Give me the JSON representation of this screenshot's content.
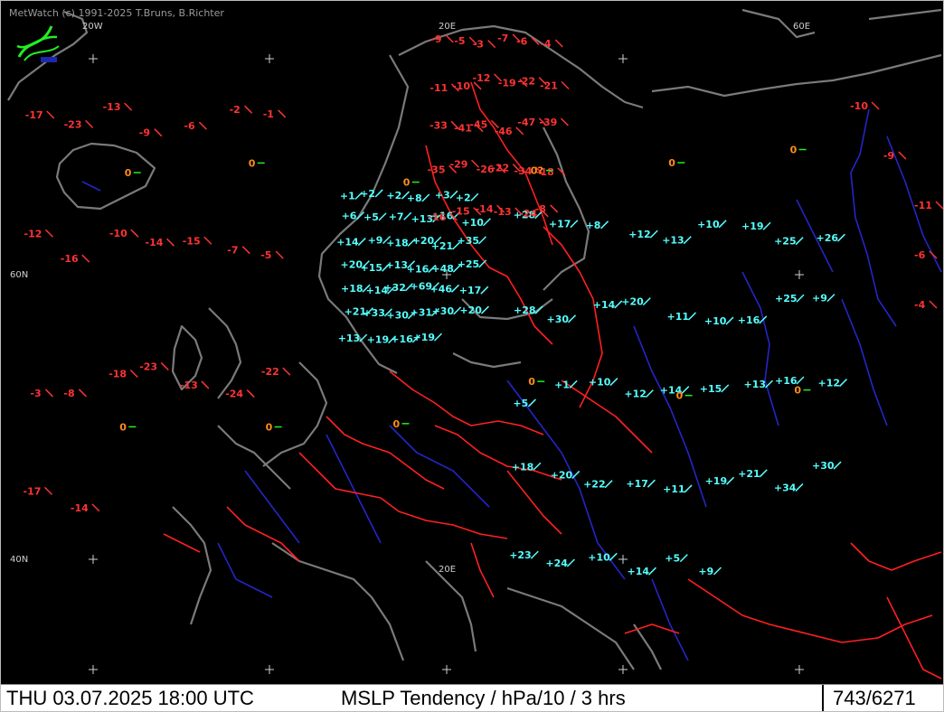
{
  "header": {
    "credit": "MetWatch  (c) 1991-2025 T.Bruns, B.Richter"
  },
  "graticule": [
    {
      "text": "20W",
      "name": "lon-label-20w"
    },
    {
      "text": "20E",
      "name": "lon-label-20e"
    },
    {
      "text": "60E",
      "name": "lon-label-60e"
    },
    {
      "text": "60N",
      "name": "lat-label-60n"
    },
    {
      "text": "40N",
      "name": "lat-label-40n"
    },
    {
      "text": "20E",
      "name": "lon-label-20e-south"
    }
  ],
  "footer": {
    "datetime": "THU 03.07.2025 18:00 UTC",
    "parameter": "MSLP Tendency / hPa/10 / 3 hrs",
    "station_count": "743/6271"
  },
  "legend": {
    "rising_color": "#55ffff",
    "falling_color": "#ff3333",
    "steady_color": "#ff8c1a",
    "border_color": "#ff2020",
    "coast_color": "#7a7a7a",
    "river_color": "#2525c8"
  },
  "observations": [
    {
      "v": "+1",
      "c": "r"
    },
    {
      "v": "+2",
      "c": "r"
    },
    {
      "v": "+2",
      "c": "r"
    },
    {
      "v": "+8",
      "c": "r"
    },
    {
      "v": "+3",
      "c": "r"
    },
    {
      "v": "+2",
      "c": "r"
    },
    {
      "v": "+6",
      "c": "r"
    },
    {
      "v": "+5",
      "c": "r"
    },
    {
      "v": "+7",
      "c": "r"
    },
    {
      "v": "+13",
      "c": "r"
    },
    {
      "v": "+16",
      "c": "r"
    },
    {
      "v": "+10",
      "c": "r"
    },
    {
      "v": "+14",
      "c": "r"
    },
    {
      "v": "+9",
      "c": "r"
    },
    {
      "v": "+18",
      "c": "r"
    },
    {
      "v": "+20",
      "c": "r"
    },
    {
      "v": "+21",
      "c": "r"
    },
    {
      "v": "+35",
      "c": "r"
    },
    {
      "v": "+20",
      "c": "r"
    },
    {
      "v": "+15",
      "c": "r"
    },
    {
      "v": "+13",
      "c": "r"
    },
    {
      "v": "+16",
      "c": "r"
    },
    {
      "v": "+48",
      "c": "r"
    },
    {
      "v": "+25",
      "c": "r"
    },
    {
      "v": "+18",
      "c": "r"
    },
    {
      "v": "+14",
      "c": "r"
    },
    {
      "v": "+32",
      "c": "r"
    },
    {
      "v": "+69",
      "c": "r"
    },
    {
      "v": "+46",
      "c": "r"
    },
    {
      "v": "+17",
      "c": "r"
    },
    {
      "v": "+21",
      "c": "r"
    },
    {
      "v": "+33",
      "c": "r"
    },
    {
      "v": "+30",
      "c": "r"
    },
    {
      "v": "+31",
      "c": "r"
    },
    {
      "v": "+30",
      "c": "r"
    },
    {
      "v": "+20",
      "c": "r"
    },
    {
      "v": "+13",
      "c": "r"
    },
    {
      "v": "+19",
      "c": "r"
    },
    {
      "v": "+16",
      "c": "r"
    },
    {
      "v": "+19",
      "c": "r"
    },
    {
      "v": "+28",
      "c": "r"
    },
    {
      "v": "+17",
      "c": "r"
    },
    {
      "v": "+8",
      "c": "r"
    },
    {
      "v": "+12",
      "c": "r"
    },
    {
      "v": "+13",
      "c": "r"
    },
    {
      "v": "+10",
      "c": "r"
    },
    {
      "v": "+19",
      "c": "r"
    },
    {
      "v": "+25",
      "c": "r"
    },
    {
      "v": "+26",
      "c": "r"
    },
    {
      "v": "+28",
      "c": "r"
    },
    {
      "v": "+30",
      "c": "r"
    },
    {
      "v": "+14",
      "c": "r"
    },
    {
      "v": "+20",
      "c": "r"
    },
    {
      "v": "+11",
      "c": "r"
    },
    {
      "v": "+10",
      "c": "r"
    },
    {
      "v": "+16",
      "c": "r"
    },
    {
      "v": "+25",
      "c": "r"
    },
    {
      "v": "+9",
      "c": "r"
    },
    {
      "v": "+5",
      "c": "r"
    },
    {
      "v": "+1",
      "c": "r"
    },
    {
      "v": "+10",
      "c": "r"
    },
    {
      "v": "+12",
      "c": "r"
    },
    {
      "v": "+14",
      "c": "r"
    },
    {
      "v": "+15",
      "c": "r"
    },
    {
      "v": "+13",
      "c": "r"
    },
    {
      "v": "+16",
      "c": "r"
    },
    {
      "v": "+12",
      "c": "r"
    },
    {
      "v": "+18",
      "c": "r"
    },
    {
      "v": "+20",
      "c": "r"
    },
    {
      "v": "+22",
      "c": "r"
    },
    {
      "v": "+17",
      "c": "r"
    },
    {
      "v": "+11",
      "c": "r"
    },
    {
      "v": "+19",
      "c": "r"
    },
    {
      "v": "+21",
      "c": "r"
    },
    {
      "v": "+34",
      "c": "r"
    },
    {
      "v": "+30",
      "c": "r"
    },
    {
      "v": "+23",
      "c": "r"
    },
    {
      "v": "+24",
      "c": "r"
    },
    {
      "v": "+10",
      "c": "r"
    },
    {
      "v": "+14",
      "c": "r"
    },
    {
      "v": "+5",
      "c": "r"
    },
    {
      "v": "+9",
      "c": "r"
    },
    {
      "v": "-9",
      "c": "f"
    },
    {
      "v": "-5",
      "c": "f"
    },
    {
      "v": "-3",
      "c": "f"
    },
    {
      "v": "-7",
      "c": "f"
    },
    {
      "v": "-6",
      "c": "f"
    },
    {
      "v": "-4",
      "c": "f"
    },
    {
      "v": "-11",
      "c": "f"
    },
    {
      "v": "-10",
      "c": "f"
    },
    {
      "v": "-12",
      "c": "f"
    },
    {
      "v": "-19",
      "c": "f"
    },
    {
      "v": "-22",
      "c": "f"
    },
    {
      "v": "-21",
      "c": "f"
    },
    {
      "v": "-33",
      "c": "f"
    },
    {
      "v": "-41",
      "c": "f"
    },
    {
      "v": "-45",
      "c": "f"
    },
    {
      "v": "-46",
      "c": "f"
    },
    {
      "v": "-47",
      "c": "f"
    },
    {
      "v": "-39",
      "c": "f"
    },
    {
      "v": "-35",
      "c": "f"
    },
    {
      "v": "-29",
      "c": "f"
    },
    {
      "v": "-26",
      "c": "f"
    },
    {
      "v": "-22",
      "c": "f"
    },
    {
      "v": "-34",
      "c": "f"
    },
    {
      "v": "-18",
      "c": "f"
    },
    {
      "v": "-16",
      "c": "f"
    },
    {
      "v": "-15",
      "c": "f"
    },
    {
      "v": "-14",
      "c": "f"
    },
    {
      "v": "-13",
      "c": "f"
    },
    {
      "v": "-24",
      "c": "f"
    },
    {
      "v": "-8",
      "c": "f"
    },
    {
      "v": "-17",
      "c": "f"
    },
    {
      "v": "-23",
      "c": "f"
    },
    {
      "v": "-13",
      "c": "f"
    },
    {
      "v": "-9",
      "c": "f"
    },
    {
      "v": "-6",
      "c": "f"
    },
    {
      "v": "-2",
      "c": "f"
    },
    {
      "v": "-1",
      "c": "f"
    },
    {
      "v": "-12",
      "c": "f"
    },
    {
      "v": "-16",
      "c": "f"
    },
    {
      "v": "-10",
      "c": "f"
    },
    {
      "v": "-14",
      "c": "f"
    },
    {
      "v": "-15",
      "c": "f"
    },
    {
      "v": "-7",
      "c": "f"
    },
    {
      "v": "-5",
      "c": "f"
    },
    {
      "v": "-3",
      "c": "f"
    },
    {
      "v": "-8",
      "c": "f"
    },
    {
      "v": "-18",
      "c": "f"
    },
    {
      "v": "-23",
      "c": "f"
    },
    {
      "v": "-13",
      "c": "f"
    },
    {
      "v": "-24",
      "c": "f"
    },
    {
      "v": "-22",
      "c": "f"
    },
    {
      "v": "-17",
      "c": "f"
    },
    {
      "v": "-14",
      "c": "f"
    },
    {
      "v": "-10",
      "c": "f"
    },
    {
      "v": "-9",
      "c": "f"
    },
    {
      "v": "-11",
      "c": "f"
    },
    {
      "v": "-6",
      "c": "f"
    },
    {
      "v": "-4",
      "c": "f"
    },
    {
      "v": "0",
      "c": "s"
    },
    {
      "v": "0",
      "c": "s"
    },
    {
      "v": "0",
      "c": "s"
    },
    {
      "v": "0?",
      "c": "s"
    },
    {
      "v": "0",
      "c": "s"
    },
    {
      "v": "0",
      "c": "s"
    },
    {
      "v": "0",
      "c": "s"
    },
    {
      "v": "0",
      "c": "s"
    },
    {
      "v": "0",
      "c": "s"
    },
    {
      "v": "0",
      "c": "s"
    },
    {
      "v": "0",
      "c": "s"
    },
    {
      "v": "0",
      "c": "s"
    }
  ]
}
